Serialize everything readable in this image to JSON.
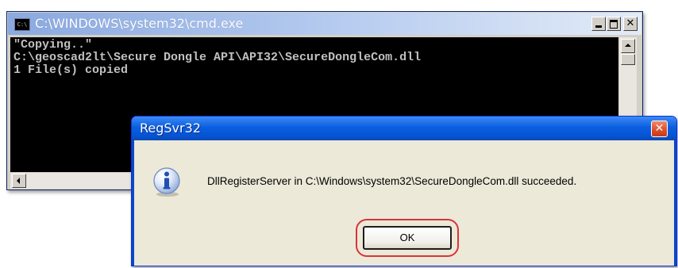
{
  "cmd_window": {
    "title": "C:\\WINDOWS\\system32\\cmd.exe",
    "icon_label": "C:\\",
    "buttons": {
      "minimize": "minimize",
      "maximize": "maximize",
      "close": "close"
    },
    "console_lines": [
      "\"Copying..\"",
      "C:\\geoscad2lt\\Secure Dongle API\\API32\\SecureDongleCom.dll",
      "1 File(s) copied"
    ]
  },
  "dialog": {
    "title": "RegSvr32",
    "icon": "info-icon",
    "message": "DllRegisterServer in C:\\Windows\\system32\\SecureDongleCom.dll succeeded.",
    "ok_label": "OK",
    "highlight_color": "#d9343a"
  },
  "colors": {
    "cmd_title_gradient_start": "#8aa9e0",
    "xp_title_blue": "#0554d4",
    "close_red": "#e0502d",
    "dialog_bg": "#ece9d8",
    "console_bg": "#000000",
    "console_text": "#c0c0c0"
  }
}
